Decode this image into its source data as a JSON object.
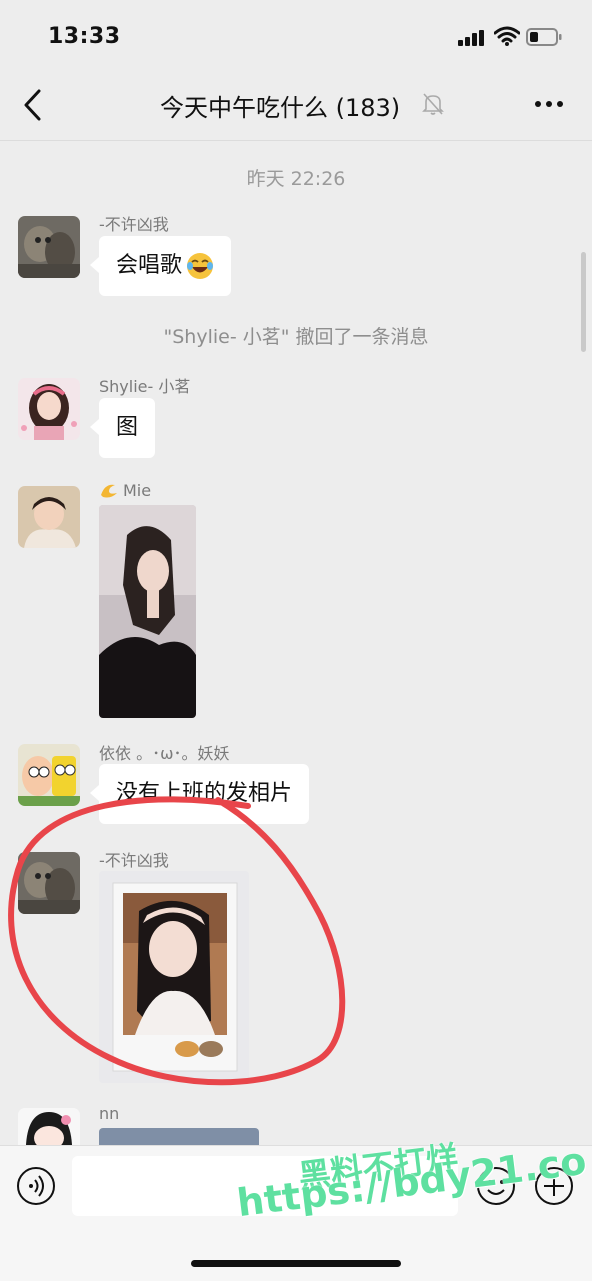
{
  "status_bar": {
    "time": "13:33"
  },
  "chat": {
    "title": "今天中午吃什么 (183)"
  },
  "messages": {
    "timestamp": "昨天 22:26",
    "m1": {
      "sender": "-不许凶我",
      "text": "会唱歌"
    },
    "recall": "\"Shylie- 小茗\" 撤回了一条消息",
    "m2": {
      "sender": "Shylie- 小茗",
      "text": "图"
    },
    "m3": {
      "sender": "Mie"
    },
    "m4": {
      "sender": "依依 。･ω･。妖妖",
      "text": "没有上班的发相片"
    },
    "m5": {
      "sender": "-不许凶我"
    },
    "m6": {
      "sender": "nn"
    }
  },
  "watermark": {
    "line1": "黑料不打烊",
    "line2": "https://bdy21.co"
  },
  "colors": {
    "background": "#ededed",
    "bubble": "#ffffff",
    "annotation_circle": "#e8454a",
    "watermark": "#5ee0a0"
  },
  "icons": [
    "signal-icon",
    "wifi-icon",
    "battery-icon",
    "back-icon",
    "mute-bell-icon",
    "more-icon",
    "laugh-cry-emoji-icon",
    "dizzy-emoji-icon",
    "voice-icon",
    "emoji-icon",
    "plus-icon"
  ]
}
